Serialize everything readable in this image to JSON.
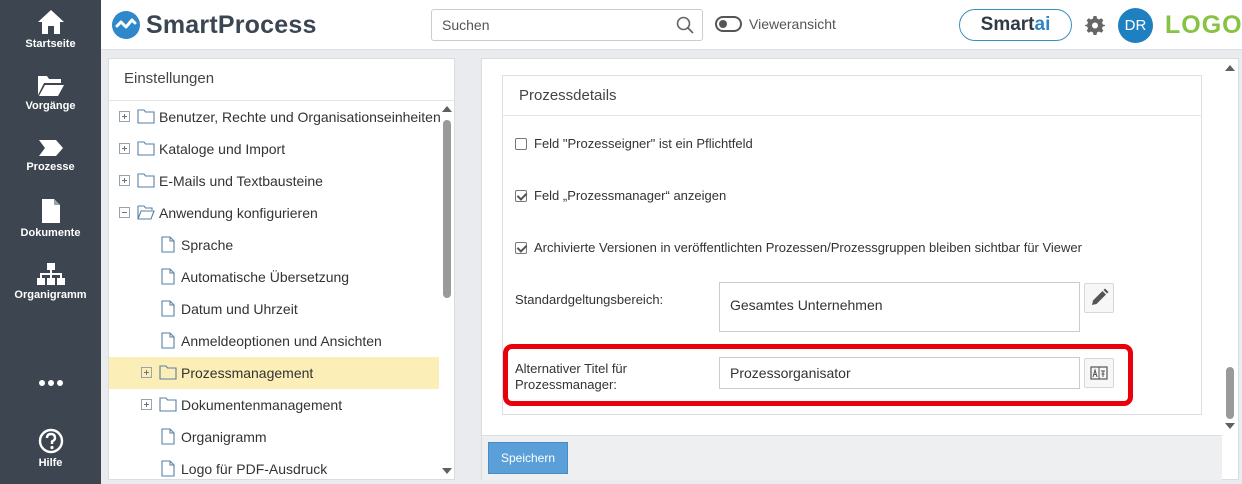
{
  "nav": {
    "items": [
      {
        "label": "Startseite",
        "icon": "home-icon"
      },
      {
        "label": "Vorgänge",
        "icon": "folder-open-icon"
      },
      {
        "label": "Prozesse",
        "icon": "process-arrow-icon"
      },
      {
        "label": "Dokumente",
        "icon": "document-icon"
      },
      {
        "label": "Organigramm",
        "icon": "org-chart-icon"
      },
      {
        "label": "Hilfe",
        "icon": "help-icon"
      }
    ]
  },
  "header": {
    "brand": "SmartProcess",
    "search_placeholder": "Suchen",
    "viewer_label": "Vieweransicht",
    "smartai_prefix": "Smart",
    "smartai_suffix": "ai",
    "avatar": "DR",
    "logo": "LOGO"
  },
  "tree": {
    "title": "Einstellungen",
    "items": [
      {
        "label": "Benutzer, Rechte und Organisationseinheiten"
      },
      {
        "label": "Kataloge und Import"
      },
      {
        "label": "E-Mails und Textbausteine"
      },
      {
        "label": "Anwendung konfigurieren"
      },
      {
        "label": "Sprache"
      },
      {
        "label": "Automatische Übersetzung"
      },
      {
        "label": "Datum und Uhrzeit"
      },
      {
        "label": "Anmeldeoptionen und Ansichten"
      },
      {
        "label": "Prozessmanagement"
      },
      {
        "label": "Dokumentenmanagement"
      },
      {
        "label": "Organigramm"
      },
      {
        "label": "Logo für PDF-Ausdruck"
      }
    ]
  },
  "details": {
    "title": "Prozessdetails",
    "checks": [
      {
        "label": "Feld \"Prozesseigner\" ist ein Pflichtfeld",
        "checked": false
      },
      {
        "label": "Feld „Prozessmanager“ anzeigen",
        "checked": true
      },
      {
        "label": "Archivierte Versionen in veröffentlichten Prozessen/Prozessgruppen bleiben sichtbar für Viewer",
        "checked": true
      }
    ],
    "scope_label": "Standardgeltungsbereich:",
    "scope_value": "Gesamtes Unternehmen",
    "alt_title_label_1": "Alternativer Titel für",
    "alt_title_label_2": "Prozessmanager:",
    "alt_title_value": "Prozessorganisator",
    "save_label": "Speichern"
  },
  "colors": {
    "nav_bg": "#3d4650",
    "accent": "#1f80c1",
    "logo": "#86c340",
    "highlight": "#e8000b",
    "selected_row": "#fbeeb6"
  }
}
